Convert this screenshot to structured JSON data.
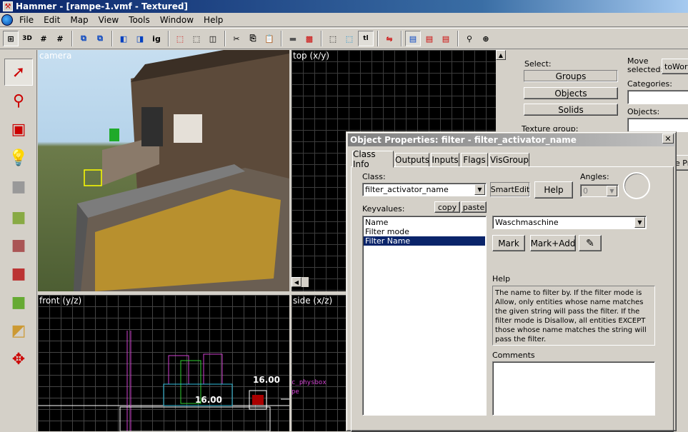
{
  "window": {
    "title": "Hammer - [rampe-1.vmf - Textured]"
  },
  "menu": [
    "File",
    "Edit",
    "Map",
    "View",
    "Tools",
    "Window",
    "Help"
  ],
  "viewports": {
    "camera": "camera",
    "top": "top (x/y)",
    "front": "front (y/z)",
    "side": "side (x/z)"
  },
  "front_labels": {
    "dim1": "16.00",
    "dim2": "16.00"
  },
  "side_labels": {
    "physbox": "c_physbox",
    "e": "pe"
  },
  "selection_panel": {
    "select_label": "Select:",
    "groups": "Groups",
    "objects": "Objects",
    "solids": "Solids",
    "texture_group": "Texture group:",
    "move_selected": "Move selected:",
    "to_world": "toWorld",
    "categories": "Categories:",
    "objects_label": "Objects:",
    "partial": "e Pr"
  },
  "dialog": {
    "title": "Object Properties: filter - filter_activator_name",
    "tabs": [
      "Class Info",
      "Outputs",
      "Inputs",
      "Flags",
      "VisGroup"
    ],
    "class_label": "Class:",
    "class_value": "filter_activator_name",
    "smartedit": "SmartEdit",
    "help_btn": "Help",
    "angles_label": "Angles:",
    "angles_value": "0",
    "keyvalues_label": "Keyvalues:",
    "copy": "copy",
    "paste": "paste",
    "keyvalues": [
      "Name",
      "Filter mode",
      "Filter Name"
    ],
    "selected_index": 2,
    "value": "Waschmaschine",
    "mark": "Mark",
    "mark_add": "Mark+Add",
    "help_label": "Help",
    "help_text": "The name to filter by. If the filter mode is Allow, only entities whose name matches the given string will pass the filter. If the filter mode is Disallow, all entities EXCEPT those whose name matches the string will pass the filter.",
    "comments_label": "Comments"
  }
}
